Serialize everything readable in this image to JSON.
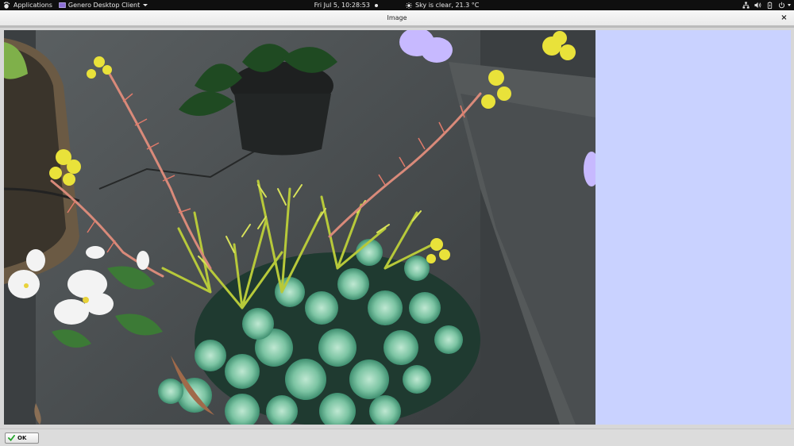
{
  "topbar": {
    "applications_label": "Applications",
    "app_name": "Genero Desktop Client",
    "clock": "Fri Jul  5, 10:28:53",
    "weather": "Sky is clear, 21.3 °C"
  },
  "window": {
    "title": "Image",
    "close_glyph": "×"
  },
  "dialog": {
    "ok_label": "OK"
  },
  "colors": {
    "topbar_bg": "#0f0f0f",
    "blank_panel": "#c9d2ff",
    "ok_check": "#22a52a"
  },
  "icons": [
    "gnome-foot-icon",
    "genero-app-icon",
    "weather-sun-icon",
    "network-icon",
    "volume-icon",
    "battery-icon",
    "power-icon",
    "close-icon",
    "checkmark-icon"
  ]
}
